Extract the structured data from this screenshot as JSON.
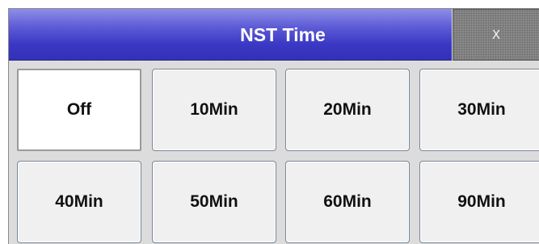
{
  "dialog": {
    "title": "NST Time",
    "close_label": "X"
  },
  "options": [
    {
      "label": "Off",
      "selected": true
    },
    {
      "label": "10Min",
      "selected": false
    },
    {
      "label": "20Min",
      "selected": false
    },
    {
      "label": "30Min",
      "selected": false
    },
    {
      "label": "40Min",
      "selected": false
    },
    {
      "label": "50Min",
      "selected": false
    },
    {
      "label": "60Min",
      "selected": false
    },
    {
      "label": "90Min",
      "selected": false
    }
  ],
  "colors": {
    "title_bar": "#3a38c4",
    "close_button": "#8a8a8a",
    "button_face": "#f0f0f0",
    "selected_face": "#ffffff"
  }
}
